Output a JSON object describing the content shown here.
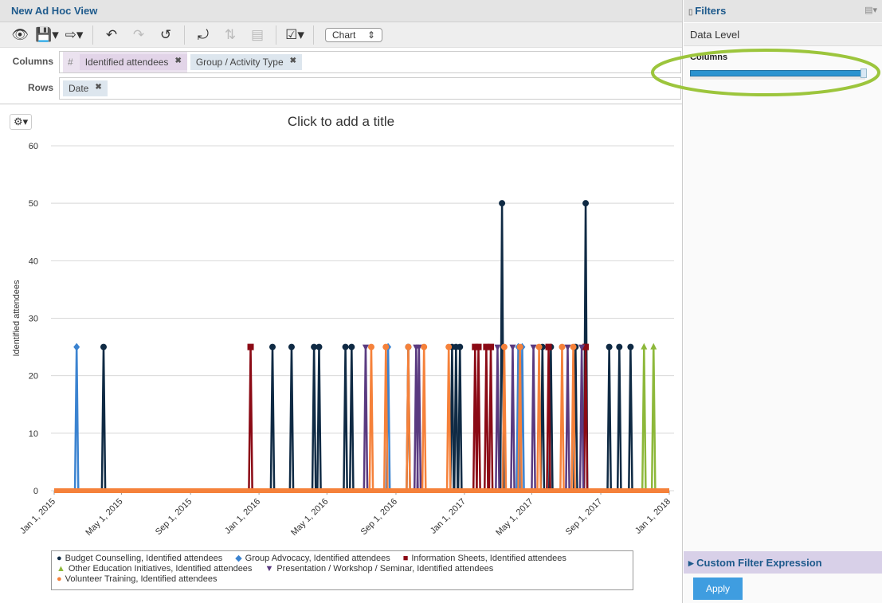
{
  "header": {
    "title": "New Ad Hoc View"
  },
  "toolbar": {
    "view_type": "Chart"
  },
  "columns": {
    "label": "Columns",
    "hash": "#",
    "pills": [
      "Identified attendees",
      "Group / Activity Type"
    ]
  },
  "rows": {
    "label": "Rows",
    "pills": [
      "Date"
    ]
  },
  "chart_title": "Click to add a title",
  "filters": {
    "title": "Filters",
    "data_level": "Data Level",
    "columns_label": "Columns",
    "slider_fraction": 1.0,
    "custom_filter": "Custom Filter Expression",
    "apply": "Apply"
  },
  "chart_data": {
    "type": "line",
    "ylabel": "Identified attendees",
    "ylim": [
      0,
      60
    ],
    "yticks": [
      0,
      10,
      20,
      30,
      40,
      50,
      60
    ],
    "xlim": [
      "2015-01-01",
      "2018-01-01"
    ],
    "xticks": [
      "Jan 1, 2015",
      "May 1, 2015",
      "Sep 1, 2015",
      "Jan 1, 2016",
      "May 1, 2016",
      "Sep 1, 2016",
      "Jan 1, 2017",
      "May 1, 2017",
      "Sep 1, 2017",
      "Jan 1, 2018"
    ],
    "xtick_dates": [
      "2015-01-01",
      "2015-05-01",
      "2015-09-01",
      "2016-01-01",
      "2016-05-01",
      "2016-09-01",
      "2017-01-01",
      "2017-05-01",
      "2017-09-01",
      "2018-01-01"
    ],
    "grid": true,
    "legend": "bottom",
    "series": [
      {
        "name": "Budget Counselling, Identified attendees",
        "color": "#0f2a44",
        "marker": "circle",
        "points": [
          [
            "2015-03-30",
            25
          ],
          [
            "2016-01-25",
            25
          ],
          [
            "2016-02-28",
            25
          ],
          [
            "2016-04-08",
            25
          ],
          [
            "2016-04-17",
            25
          ],
          [
            "2016-06-03",
            25
          ],
          [
            "2016-06-14",
            25
          ],
          [
            "2016-09-23",
            25
          ],
          [
            "2016-12-10",
            25
          ],
          [
            "2016-12-17",
            25
          ],
          [
            "2016-12-24",
            25
          ],
          [
            "2017-03-09",
            50
          ],
          [
            "2017-05-20",
            25
          ],
          [
            "2017-06-04",
            25
          ],
          [
            "2017-07-18",
            25
          ],
          [
            "2017-08-05",
            50
          ],
          [
            "2017-09-16",
            25
          ],
          [
            "2017-10-04",
            25
          ],
          [
            "2017-10-24",
            25
          ]
        ]
      },
      {
        "name": "Group Advocacy, Identified attendees",
        "color": "#3b83d0",
        "marker": "diamond",
        "points": [
          [
            "2015-02-10",
            25
          ],
          [
            "2016-08-18",
            25
          ],
          [
            "2017-04-07",
            25
          ],
          [
            "2017-04-14",
            25
          ]
        ]
      },
      {
        "name": "Information Sheets, Identified attendees",
        "color": "#8b0a15",
        "marker": "square",
        "points": [
          [
            "2015-12-17",
            25
          ],
          [
            "2017-01-20",
            25
          ],
          [
            "2017-01-26",
            25
          ],
          [
            "2017-02-09",
            25
          ],
          [
            "2017-02-17",
            25
          ],
          [
            "2017-05-31",
            25
          ],
          [
            "2017-08-05",
            25
          ]
        ]
      },
      {
        "name": "Other Education Initiatives, Identified attendees",
        "color": "#8db83a",
        "marker": "triangle",
        "points": [
          [
            "2017-11-17",
            25
          ],
          [
            "2017-12-04",
            25
          ]
        ]
      },
      {
        "name": "Presentation / Workshop / Seminar, Identified attendees",
        "color": "#5a3a80",
        "marker": "triangle-down",
        "points": [
          [
            "2016-07-09",
            25
          ],
          [
            "2016-10-07",
            25
          ],
          [
            "2016-10-12",
            25
          ],
          [
            "2017-03-01",
            25
          ],
          [
            "2017-03-28",
            25
          ],
          [
            "2017-05-04",
            25
          ],
          [
            "2017-07-04",
            25
          ],
          [
            "2017-07-29",
            25
          ]
        ]
      },
      {
        "name": "Volunteer Training, Identified attendees",
        "color": "#f5813a",
        "marker": "circle",
        "points": [
          [
            "2016-07-19",
            25
          ],
          [
            "2016-08-14",
            25
          ],
          [
            "2016-09-23",
            25
          ],
          [
            "2016-10-21",
            25
          ],
          [
            "2016-12-04",
            25
          ],
          [
            "2017-03-13",
            25
          ],
          [
            "2017-04-10",
            25
          ],
          [
            "2017-05-14",
            25
          ],
          [
            "2017-06-24",
            25
          ],
          [
            "2017-07-14",
            25
          ]
        ]
      }
    ]
  }
}
